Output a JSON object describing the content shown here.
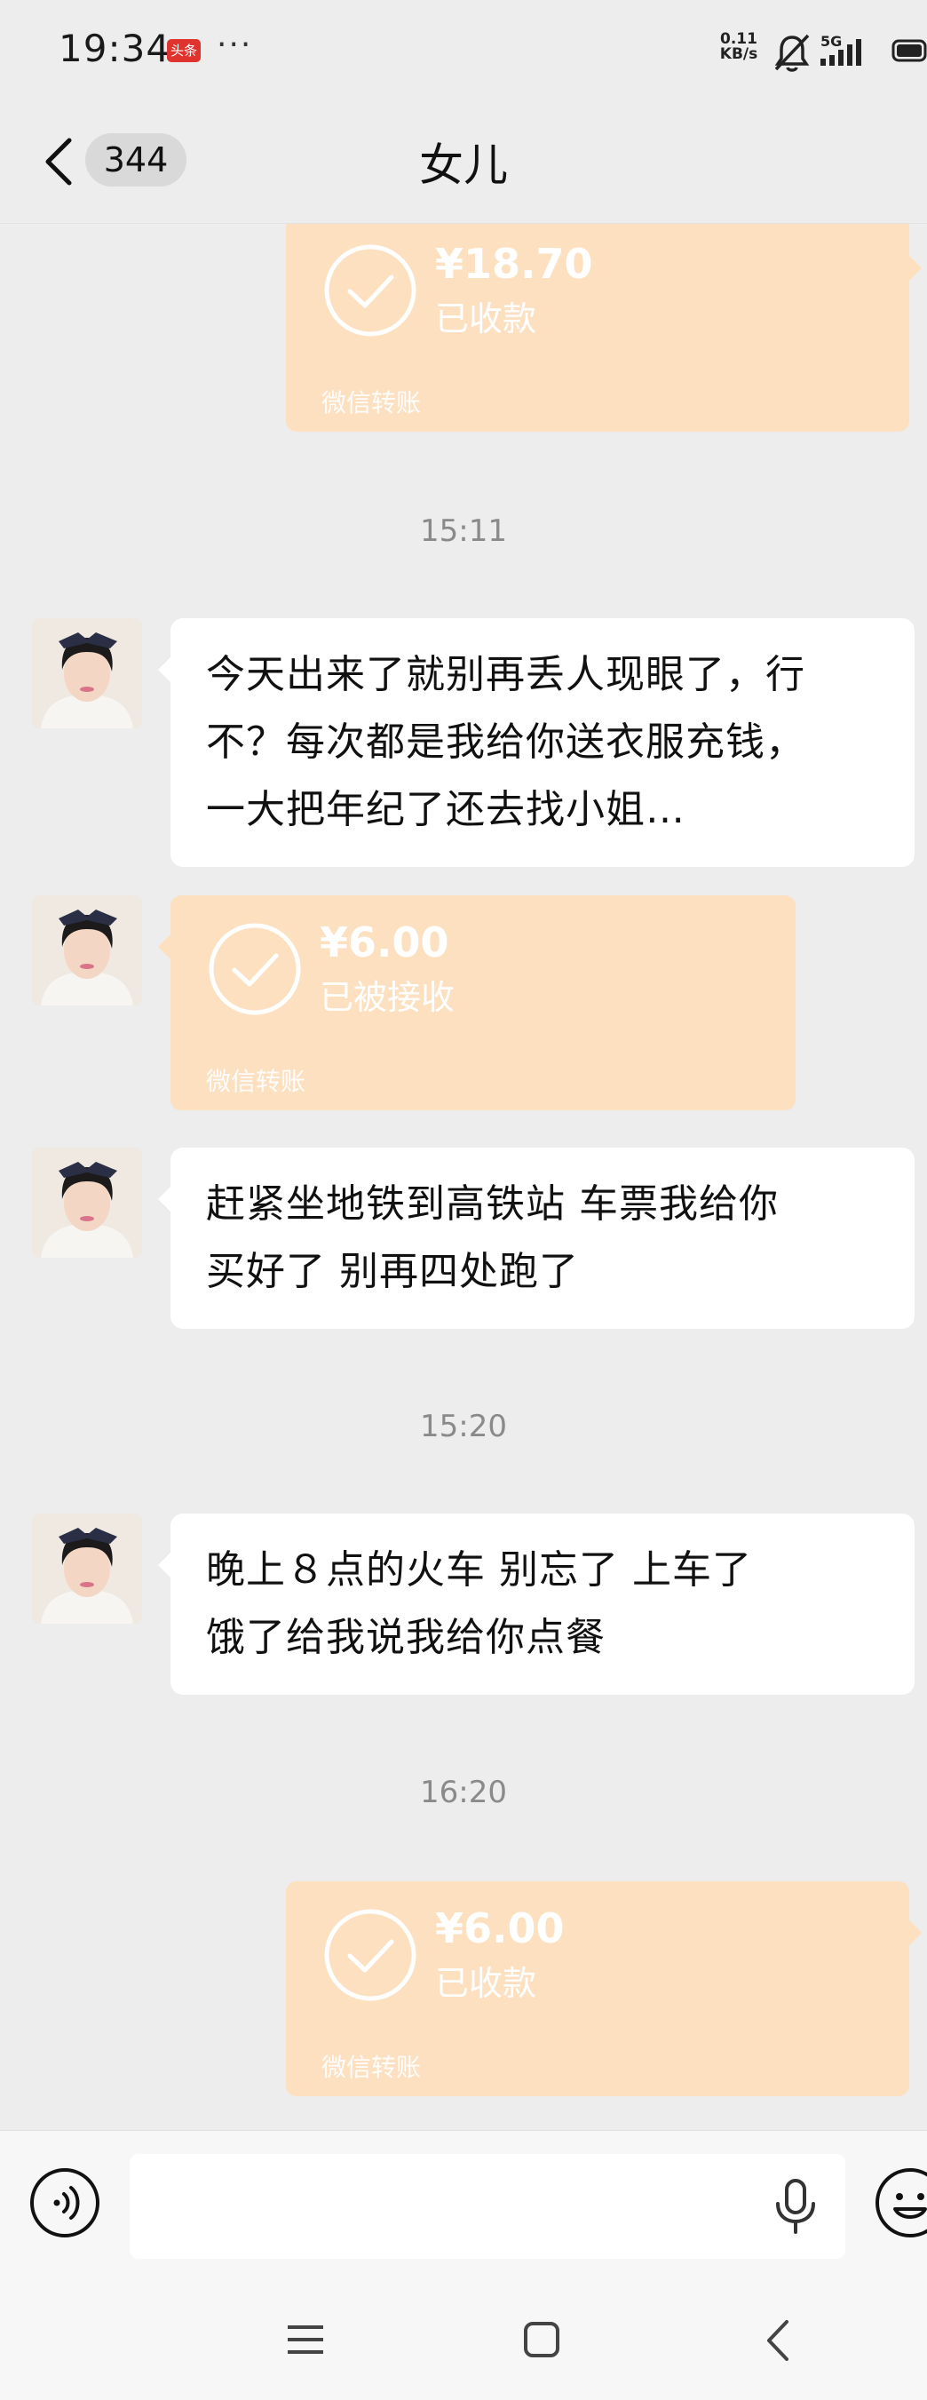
{
  "status_bar": {
    "time": "19:34",
    "app_badge": "头条",
    "more": "···",
    "net_speed_value": "0.11",
    "net_speed_unit": "KB/s",
    "network": "5G"
  },
  "header": {
    "unread_count": "344",
    "title": "女儿"
  },
  "messages": [
    {
      "type": "transfer",
      "direction": "sent",
      "amount": "¥18.70",
      "status": "已收款",
      "label": "微信转账"
    },
    {
      "type": "timestamp",
      "text": "15:11"
    },
    {
      "type": "text",
      "direction": "received",
      "lines": [
        "今天出来了就别再丢人现眼了，行",
        "不？每次都是我给你送衣服充钱，",
        "一大把年纪了还去找小姐…"
      ]
    },
    {
      "type": "transfer",
      "direction": "received",
      "amount": "¥6.00",
      "status": "已被接收",
      "label": "微信转账"
    },
    {
      "type": "text",
      "direction": "received",
      "lines": [
        "赶紧坐地铁到高铁站 车票我给你",
        "买好了 别再四处跑了"
      ]
    },
    {
      "type": "timestamp",
      "text": "15:20"
    },
    {
      "type": "text",
      "direction": "received",
      "lines": [
        "晚上８点的火车  别忘了   上车了",
        "饿了给我说我给你点餐"
      ]
    },
    {
      "type": "timestamp",
      "text": "16:20"
    },
    {
      "type": "transfer",
      "direction": "sent",
      "amount": "¥6.00",
      "status": "已收款",
      "label": "微信转账"
    }
  ],
  "input_bar": {
    "text_value": "",
    "voice_icon": "voice-icon",
    "mic_icon": "microphone-icon",
    "emoji_icon": "emoji-icon"
  },
  "nav_bar": {
    "menu_icon": "menu-icon",
    "home_icon": "home-icon",
    "back_icon": "back-icon"
  },
  "colors": {
    "background": "#ededed",
    "transfer_card": "#fde0c0",
    "bubble": "#ffffff",
    "timestamp": "#8a8a8a"
  }
}
